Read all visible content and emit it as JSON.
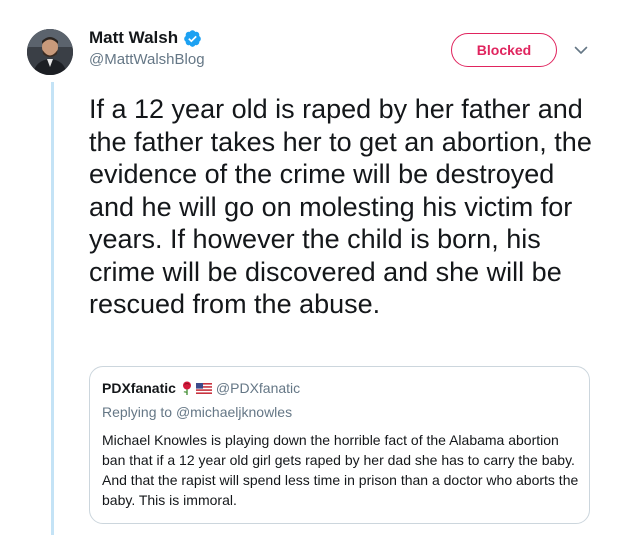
{
  "tweet": {
    "author": {
      "display_name": "Matt Walsh",
      "handle": "@MattWalshBlog",
      "verified": true,
      "avatar_icon": "avatar-photo"
    },
    "follow_button_label": "Blocked",
    "menu_icon": "chevron-down-icon",
    "text": "If a 12 year old is raped by her father and the father takes her to get an abortion, the evidence of the crime will be destroyed and he will go on molesting his victim for years. If however the child is born, his crime will be discovered and she will be rescued from the abuse."
  },
  "quoted_tweet": {
    "author": {
      "display_name": "PDXfanatic",
      "emoji": [
        "rose-icon",
        "us-flag-icon"
      ],
      "handle": "@PDXfanatic"
    },
    "replying_to_prefix": "Replying to",
    "replying_to_handle": "@michaeljknowles",
    "text": "Michael Knowles is playing down the horrible fact of the Alabama abortion ban that if a 12 year old girl gets raped by her dad she has to carry the baby. And that the rapist will spend less time in prison than a doctor who aborts the baby. This is immoral."
  },
  "colors": {
    "blocked_red": "#e0245e",
    "muted_gray": "#657786",
    "thread_line": "#c4e3f6",
    "verified_blue": "#1da1f2",
    "border": "#ccd6dd"
  }
}
